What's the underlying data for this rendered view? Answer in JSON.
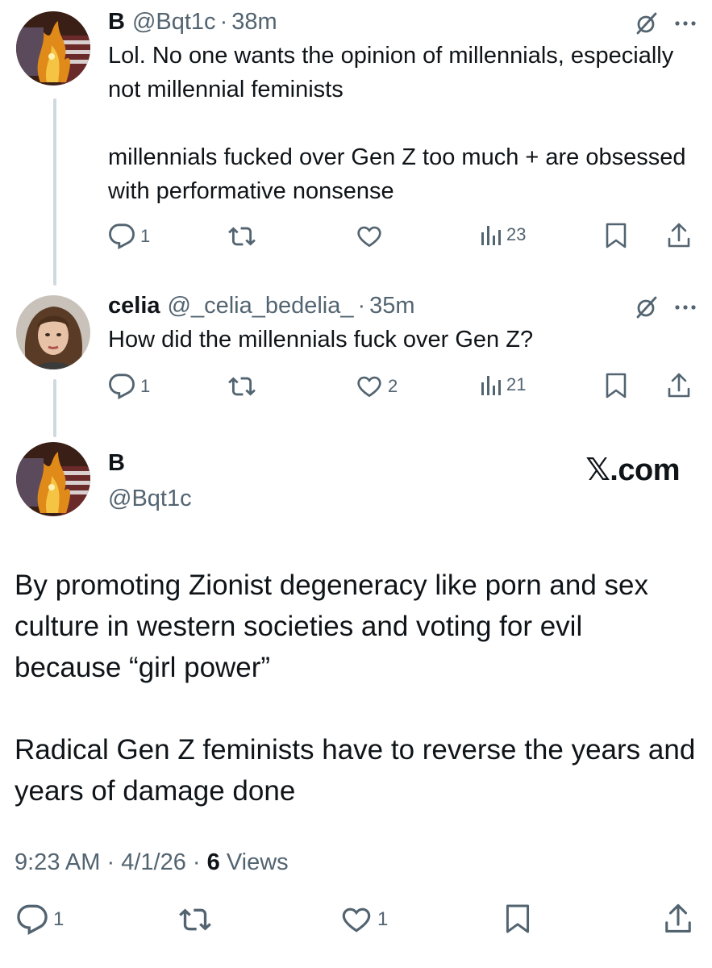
{
  "thread": [
    {
      "name": "B",
      "handle": "@Bqt1c",
      "separator": "·",
      "time": "38m",
      "paragraphs": [
        "Lol. No one wants the opinion of millennials, especially not millennial feminists",
        "",
        "millennials fucked over Gen Z too much + are obsessed with performative nonsense"
      ],
      "counts": {
        "replies": "1",
        "reposts": "",
        "likes": "",
        "views": "23"
      }
    },
    {
      "name": "celia",
      "handle": "@_celia_bedelia_",
      "separator": "·",
      "time": "35m",
      "paragraphs": [
        "How did the millennials fuck over Gen Z?"
      ],
      "counts": {
        "replies": "1",
        "reposts": "",
        "likes": "2",
        "views": "21"
      }
    }
  ],
  "main_post": {
    "name": "B",
    "handle": "@Bqt1c",
    "brand": "𝕏.com",
    "paragraphs": [
      "By promoting Zionist degeneracy like porn and sex culture in western societies and voting for evil because “girl power”",
      "",
      "Radical Gen Z feminists have to reverse the years and years of damage done"
    ],
    "meta": {
      "time": "9:23 AM",
      "sep1": "·",
      "date": "4/1/26",
      "sep2": "·",
      "views_count": "6",
      "views_label": "Views"
    },
    "counts": {
      "replies": "1",
      "reposts": "",
      "likes": "1"
    }
  },
  "icons": [
    "grok-icon",
    "more-icon",
    "reply-icon",
    "repost-icon",
    "like-icon",
    "views-icon",
    "bookmark-icon",
    "share-icon"
  ],
  "colors": {
    "text": "#0f1419",
    "secondary": "#536471",
    "thread_line": "#cfd9de"
  }
}
